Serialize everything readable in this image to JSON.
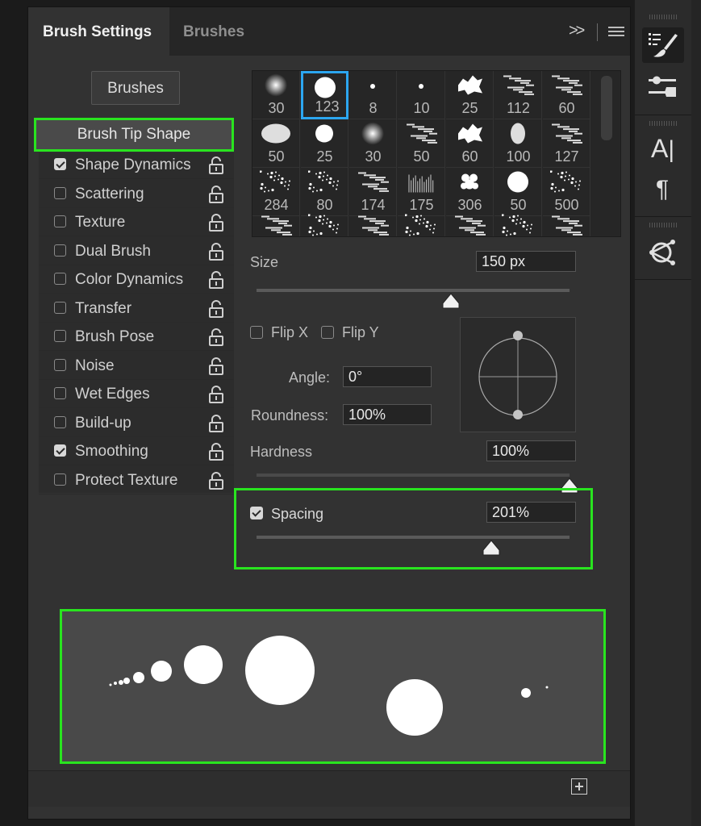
{
  "tabs": {
    "active": "Brush Settings",
    "other": "Brushes",
    "expand_glyph": ">>"
  },
  "brushes_button": "Brushes",
  "tip_shape_label": "Brush Tip Shape",
  "options": [
    {
      "label": "Shape Dynamics",
      "checked": true
    },
    {
      "label": "Scattering",
      "checked": false
    },
    {
      "label": "Texture",
      "checked": false
    },
    {
      "label": "Dual Brush",
      "checked": false
    },
    {
      "label": "Color Dynamics",
      "checked": false
    },
    {
      "label": "Transfer",
      "checked": false
    },
    {
      "label": "Brush Pose",
      "checked": false
    },
    {
      "label": "Noise",
      "checked": false
    },
    {
      "label": "Wet Edges",
      "checked": false
    },
    {
      "label": "Build-up",
      "checked": false
    },
    {
      "label": "Smoothing",
      "checked": true
    },
    {
      "label": "Protect Texture",
      "checked": false
    }
  ],
  "presets": [
    [
      "30",
      "123",
      "8",
      "10",
      "25",
      "112",
      "60"
    ],
    [
      "50",
      "25",
      "30",
      "50",
      "60",
      "100",
      "127"
    ],
    [
      "284",
      "80",
      "174",
      "175",
      "306",
      "50",
      "500"
    ]
  ],
  "selected_preset": "123",
  "size": {
    "label": "Size",
    "value": "150 px",
    "slider": 0.62
  },
  "flip_x": {
    "label": "Flip X",
    "checked": false
  },
  "flip_y": {
    "label": "Flip Y",
    "checked": false
  },
  "angle": {
    "label": "Angle:",
    "value": "0°"
  },
  "roundness": {
    "label": "Roundness:",
    "value": "100%"
  },
  "hardness": {
    "label": "Hardness",
    "value": "100%",
    "slider": 1.0
  },
  "spacing": {
    "label": "Spacing",
    "value": "201%",
    "checked": true,
    "slider": 0.75
  },
  "accent": "#29e41f",
  "selection_color": "#2ca6f0",
  "right_tools": [
    "brush-settings-icon",
    "sliders-icon",
    "character-icon",
    "paragraph-icon",
    "paths-icon"
  ]
}
